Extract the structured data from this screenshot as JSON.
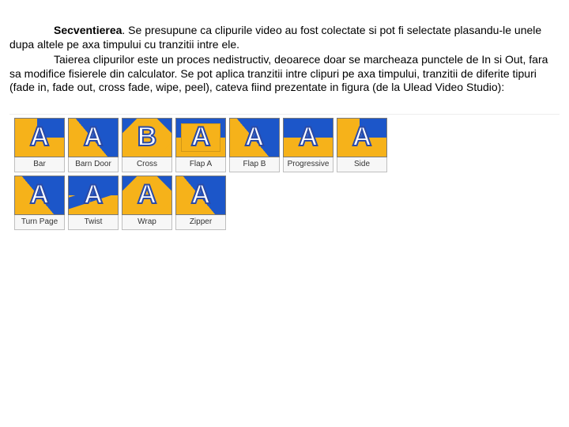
{
  "text": {
    "title_word": "Secventierea",
    "para1_after_title": ". Se presupune ca clipurile video au fost colectate si pot fi selectate plasandu-le unele dupa altele pe axa timpului cu tranzitii intre ele.",
    "para2": "Taierea clipurilor este un proces nedistructiv, deoarece doar se marcheaza punctele de In si Out, fara sa modifice fisierele din calculator. Se pot aplica tranzitii intre clipuri pe axa timpului, tranzitii de diferite tipuri (fade in, fade out, cross fade, wipe, peel), cateva fiind prezentate in figura (de la Ulead Video Studio):"
  },
  "transitions": {
    "row1": [
      {
        "label": "Bar",
        "letter": "A",
        "deco": "left"
      },
      {
        "label": "Barn Door",
        "letter": "A",
        "deco": "diag"
      },
      {
        "label": "Cross",
        "letter": "B",
        "deco": "diamond"
      },
      {
        "label": "Flap A",
        "letter": "A",
        "deco": "box"
      },
      {
        "label": "Flap B",
        "letter": "A",
        "deco": "diag"
      },
      {
        "label": "Progressive",
        "letter": "A",
        "deco": "none"
      },
      {
        "label": "Side",
        "letter": "A",
        "deco": "left"
      }
    ],
    "row2": [
      {
        "label": "Turn Page",
        "letter": "A",
        "deco": "diag"
      },
      {
        "label": "Twist",
        "letter": "A",
        "deco": "twist"
      },
      {
        "label": "Wrap",
        "letter": "A",
        "deco": "diamond"
      },
      {
        "label": "Zipper",
        "letter": "A",
        "deco": "diag"
      }
    ]
  }
}
